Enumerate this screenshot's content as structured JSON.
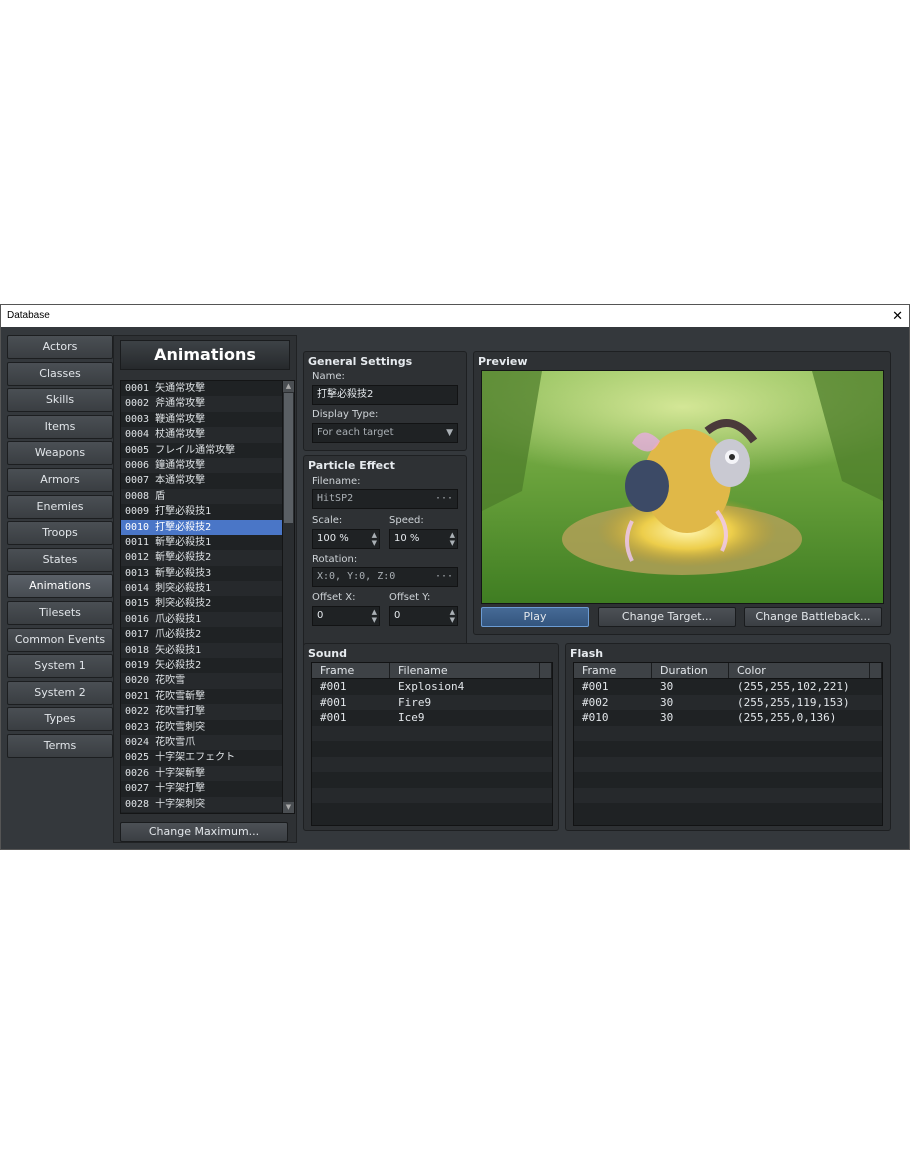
{
  "window": {
    "title": "Database",
    "close_glyph": "✕"
  },
  "nav": {
    "items": [
      "Actors",
      "Classes",
      "Skills",
      "Items",
      "Weapons",
      "Armors",
      "Enemies",
      "Troops",
      "States",
      "Animations",
      "Tilesets",
      "Common Events",
      "System 1",
      "System 2",
      "Types",
      "Terms"
    ],
    "active": "Animations"
  },
  "animations": {
    "heading": "Animations",
    "list": [
      "0001 矢通常攻撃",
      "0002 斧通常攻撃",
      "0003 鞭通常攻撃",
      "0004 杖通常攻撃",
      "0005 フレイル通常攻撃",
      "0006 鐘通常攻撃",
      "0007 本通常攻撃",
      "0008 盾",
      "0009 打撃必殺技1",
      "0010 打撃必殺技2",
      "0011 斬撃必殺技1",
      "0012 斬撃必殺技2",
      "0013 斬撃必殺技3",
      "0014 刺突必殺技1",
      "0015 刺突必殺技2",
      "0016 爪必殺技1",
      "0017 爪必殺技2",
      "0018 矢必殺技1",
      "0019 矢必殺技2",
      "0020 花吹雪",
      "0021 花吹雪斬撃",
      "0022 花吹雪打撃",
      "0023 花吹雪刺突",
      "0024 花吹雪爪",
      "0025 十字架エフェクト",
      "0026 十字架斬撃",
      "0027 十字架打撃",
      "0028 十字架刺突"
    ],
    "selected_index": 9,
    "change_max_label": "Change Maximum..."
  },
  "general": {
    "title": "General Settings",
    "name_label": "Name:",
    "name_value": "打擊必殺技2",
    "display_type_label": "Display Type:",
    "display_type_value": "For each target"
  },
  "particle": {
    "title": "Particle Effect",
    "filename_label": "Filename:",
    "filename_value": "HitSP2",
    "scale_label": "Scale:",
    "scale_value": "100 %",
    "speed_label": "Speed:",
    "speed_value": "10 %",
    "rotation_label": "Rotation:",
    "rotation_value": "X:0, Y:0, Z:0",
    "offset_x_label": "Offset X:",
    "offset_x_value": "0",
    "offset_y_label": "Offset Y:",
    "offset_y_value": "0",
    "ellipsis": "···"
  },
  "preview": {
    "title": "Preview",
    "play_label": "Play",
    "change_target_label": "Change Target...",
    "change_battleback_label": "Change Battleback..."
  },
  "sound": {
    "title": "Sound",
    "columns": [
      "Frame",
      "Filename"
    ],
    "rows": [
      [
        "#001",
        "Explosion4"
      ],
      [
        "#001",
        "Fire9"
      ],
      [
        "#001",
        "Ice9"
      ]
    ]
  },
  "flash": {
    "title": "Flash",
    "columns": [
      "Frame",
      "Duration",
      "Color"
    ],
    "rows": [
      [
        "#001",
        "30",
        "(255,255,102,221)"
      ],
      [
        "#002",
        "30",
        "(255,255,119,153)"
      ],
      [
        "#010",
        "30",
        "(255,255,0,136)"
      ]
    ]
  },
  "colors": {
    "selection": "#4a76c7",
    "window_bg": "#34383c"
  }
}
